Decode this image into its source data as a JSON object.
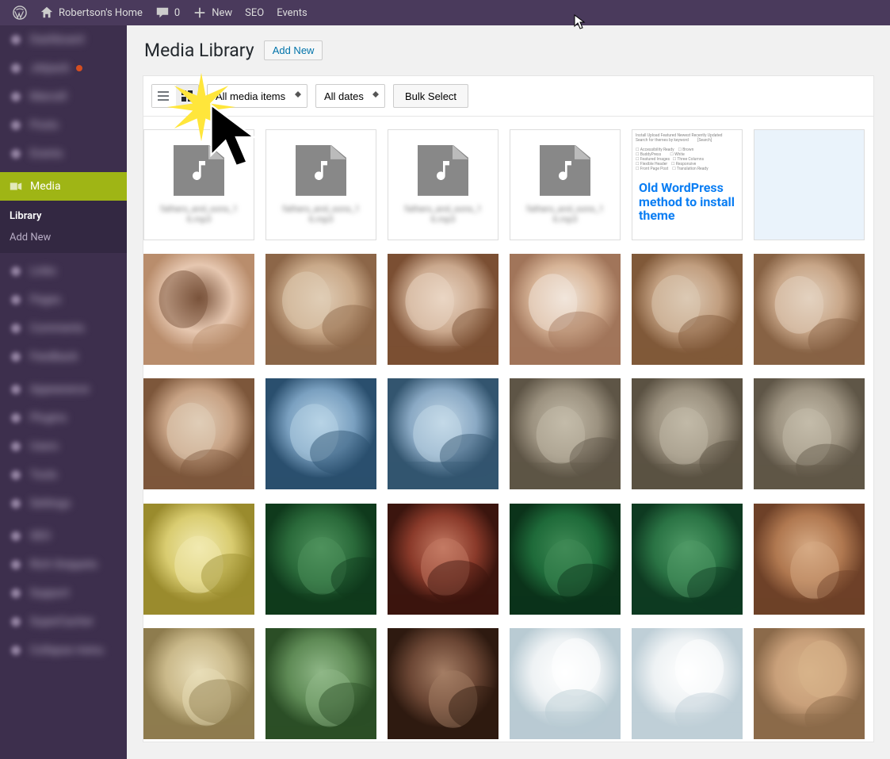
{
  "adminbar": {
    "site_name": "Robertson's Home",
    "comments_count": "0",
    "new_label": "New",
    "seo_label": "SEO",
    "events_label": "Events"
  },
  "sidebar": {
    "items": [
      {
        "label": "Dashboard",
        "blur": true
      },
      {
        "label": "Jetpack",
        "blur": true,
        "badge": true
      },
      {
        "label": "Marcell",
        "blur": true
      },
      {
        "label": "Posts",
        "blur": true
      },
      {
        "label": "Events",
        "blur": true
      }
    ],
    "media_label": "Media",
    "submenu": {
      "library": "Library",
      "addnew": "Add New"
    },
    "below": [
      {
        "label": "Links",
        "blur": true
      },
      {
        "label": "Pages",
        "blur": true
      },
      {
        "label": "Comments",
        "blur": true
      },
      {
        "label": "Feedback",
        "blur": true
      },
      {
        "label": "Appearance",
        "blur": true
      },
      {
        "label": "Plugins",
        "blur": true
      },
      {
        "label": "Users",
        "blur": true
      },
      {
        "label": "Tools",
        "blur": true
      },
      {
        "label": "Settings",
        "blur": true
      },
      {
        "label": "SEO",
        "blur": true
      },
      {
        "label": "Rich Snippets",
        "blur": true
      },
      {
        "label": "Support",
        "blur": true
      },
      {
        "label": "SuperCacher",
        "blur": true
      },
      {
        "label": "Collapse menu",
        "blur": true
      }
    ]
  },
  "page": {
    "title": "Media Library",
    "add_new": "Add New"
  },
  "toolbar": {
    "filter_media": "All media items",
    "filter_date": "All dates",
    "bulk_select": "Bulk Select"
  },
  "media": {
    "audio_caption": "fathers_and_sons_1 6.mp3",
    "theme_overlay": "Old WordPress method to install theme",
    "thumbs": [
      [
        "#c9a07a",
        "#8b6a4a",
        "#d8b38a"
      ],
      [
        "#e6c7b0",
        "#b98d6c",
        "#7a533b"
      ],
      [
        "#c9a989",
        "#8c6648",
        "#e0cdb6"
      ],
      [
        "#caa88d",
        "#7b4f33",
        "#ead6c4"
      ],
      [
        "#d7b497",
        "#a1755a",
        "#f1e6db"
      ],
      [
        "#c19e7f",
        "#805939",
        "#dcc9b4"
      ],
      [
        "#c8a688",
        "#876244",
        "#e3d2bf"
      ],
      [
        "#b99578",
        "#6e4a2d",
        "#d6c2ab"
      ],
      [
        "#c7a284",
        "#7d573b",
        "#e0cdb7"
      ],
      [
        "#7aa0c0",
        "#2a4f6e",
        "#b7d3e6"
      ],
      [
        "#8aa9c4",
        "#33556f",
        "#c4d9e8"
      ],
      [
        "#9c9280",
        "#5e5546",
        "#c3bba9"
      ],
      [
        "#9a907e",
        "#5b5243",
        "#c1b9a7"
      ],
      [
        "#9d9381",
        "#5f5647",
        "#c4bcaa"
      ],
      [
        "#cfc2a4",
        "#8f8364",
        "#eee6cf"
      ],
      [
        "#d9cc70",
        "#9a8b2d",
        "#f1eab0"
      ],
      [
        "#2a6a3a",
        "#0f3a1c",
        "#4e915c"
      ],
      [
        "#8a3a2a",
        "#3b150e",
        "#c47a63"
      ],
      [
        "#1e6a39",
        "#0b331a",
        "#3f8a55"
      ],
      [
        "#2a7344",
        "#0e3a21",
        "#4f9a66"
      ],
      [
        "#b07850",
        "#6e4128",
        "#d6aa84"
      ],
      [
        "#6a4432",
        "#2c180f",
        "#a07a60"
      ],
      [
        "#cab98a",
        "#8e7c4e",
        "#e8ddb8"
      ],
      [
        "#5e8a55",
        "#2b4e26",
        "#8fb787"
      ],
      [
        "#6b4634",
        "#2e1a10",
        "#a47d64"
      ],
      [
        "#eef2f4",
        "#b9cbd3",
        "#ffffff"
      ],
      [
        "#eef2f4",
        "#bfcfd7",
        "#ffffff"
      ]
    ]
  }
}
